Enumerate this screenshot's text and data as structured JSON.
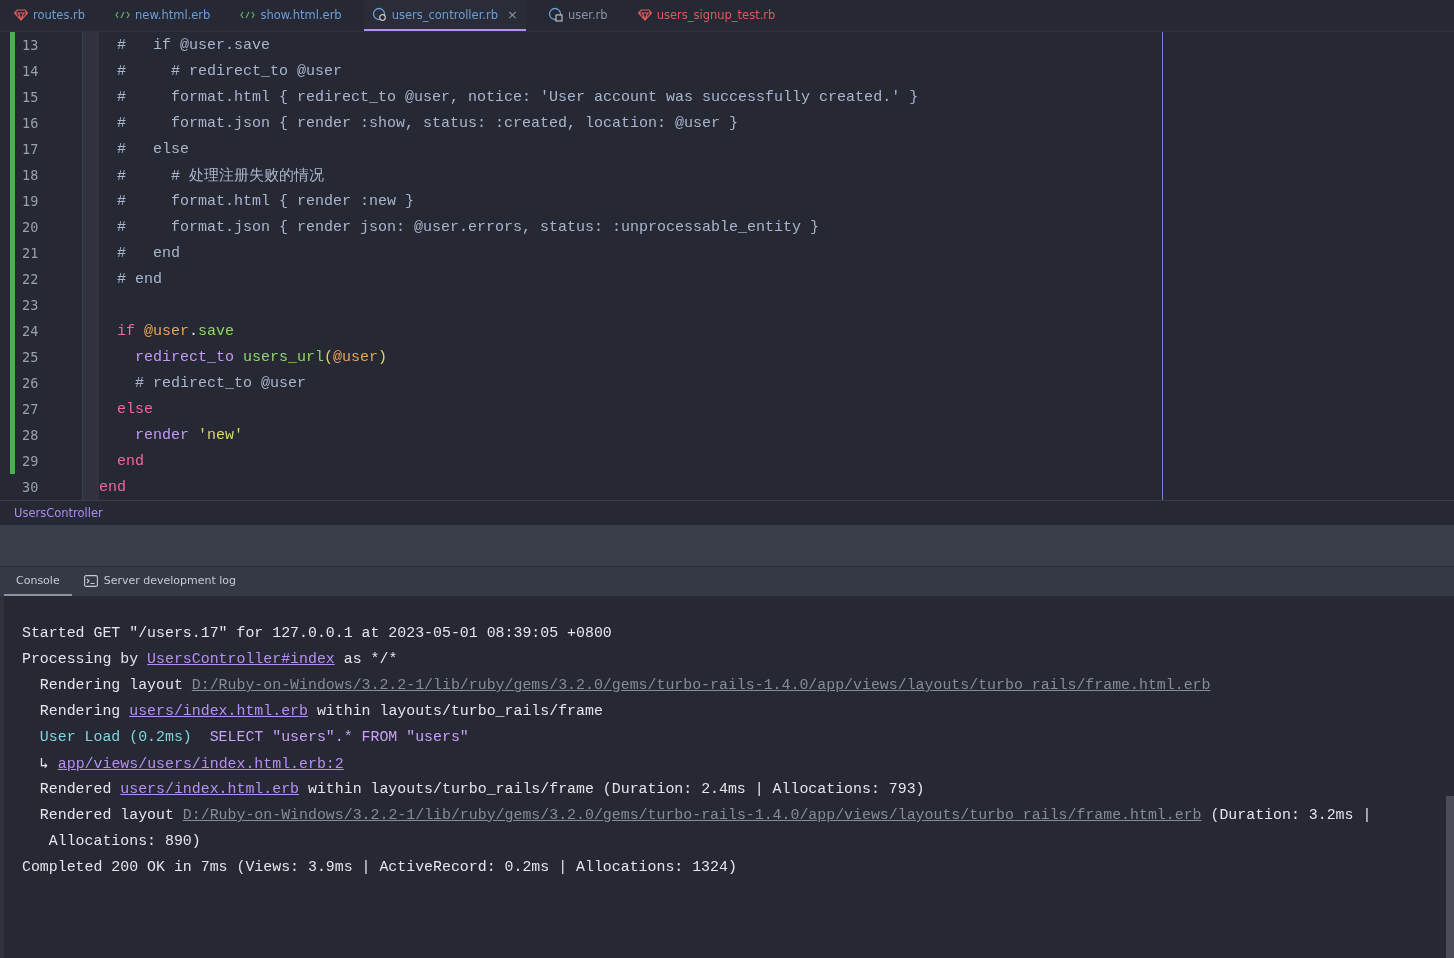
{
  "tabs": [
    {
      "label": "routes.rb",
      "kind": "gem",
      "color": "#6c9fd8",
      "selected": false
    },
    {
      "label": "new.html.erb",
      "kind": "erb",
      "color": "#6c9fd8",
      "selected": false
    },
    {
      "label": "show.html.erb",
      "kind": "erb",
      "color": "#6c9fd8",
      "selected": false
    },
    {
      "label": "users_controller.rb",
      "kind": "controller",
      "color": "#6c9fd8",
      "selected": true,
      "close": "×"
    },
    {
      "label": "user.rb",
      "kind": "model",
      "color": "#8a93a8",
      "selected": false
    },
    {
      "label": "users_signup_test.rb",
      "kind": "gem",
      "color": "#e0595e",
      "selected": false
    }
  ],
  "editor": {
    "lines": [
      {
        "number": "13",
        "modified": true,
        "tokens": [
          {
            "kind": "comment",
            "text": "  #   if @user.save"
          }
        ]
      },
      {
        "number": "14",
        "modified": true,
        "tokens": [
          {
            "kind": "comment",
            "text": "  #     # redirect_to @user"
          }
        ]
      },
      {
        "number": "15",
        "modified": true,
        "tokens": [
          {
            "kind": "comment",
            "text": "  #     format.html { redirect_to @user, notice: 'User account was successfully created.' }"
          }
        ]
      },
      {
        "number": "16",
        "modified": true,
        "tokens": [
          {
            "kind": "comment",
            "text": "  #     format.json { render :show, status: :created, location: @user }"
          }
        ]
      },
      {
        "number": "17",
        "modified": true,
        "tokens": [
          {
            "kind": "comment",
            "text": "  #   else"
          }
        ]
      },
      {
        "number": "18",
        "modified": true,
        "tokens": [
          {
            "kind": "comment",
            "text": "  #     # 处理注册失败的情况"
          }
        ]
      },
      {
        "number": "19",
        "modified": true,
        "tokens": [
          {
            "kind": "comment",
            "text": "  #     format.html { render :new }"
          }
        ]
      },
      {
        "number": "20",
        "modified": true,
        "tokens": [
          {
            "kind": "comment",
            "text": "  #     format.json { render json: @user.errors, status: :unprocessable_entity }"
          }
        ]
      },
      {
        "number": "21",
        "modified": true,
        "tokens": [
          {
            "kind": "comment",
            "text": "  #   end"
          }
        ]
      },
      {
        "number": "22",
        "modified": true,
        "tokens": [
          {
            "kind": "comment",
            "text": "  # end"
          }
        ]
      },
      {
        "number": "23",
        "modified": true
      },
      {
        "number": "24",
        "modified": true,
        "tokens": [
          {
            "kind": "keyword",
            "text": "  if "
          },
          {
            "kind": "ivar",
            "text": "@user"
          },
          {
            "kind": "plain",
            "text": "."
          },
          {
            "kind": "method",
            "text": "save"
          }
        ]
      },
      {
        "number": "25",
        "modified": true,
        "tokens": [
          {
            "kind": "call",
            "text": "    redirect_to "
          },
          {
            "kind": "method",
            "text": "users_url"
          },
          {
            "kind": "paren",
            "text": "("
          },
          {
            "kind": "ivar",
            "text": "@user"
          },
          {
            "kind": "paren",
            "text": ")"
          }
        ]
      },
      {
        "number": "26",
        "modified": true,
        "tokens": [
          {
            "kind": "comment",
            "text": "    # redirect_to @user"
          }
        ]
      },
      {
        "number": "27",
        "modified": true,
        "tokens": [
          {
            "kind": "keyword",
            "text": "  else"
          }
        ]
      },
      {
        "number": "28",
        "modified": true,
        "tokens": [
          {
            "kind": "call",
            "text": "    render "
          },
          {
            "kind": "string",
            "text": "'new'"
          }
        ]
      },
      {
        "number": "29",
        "modified": true,
        "tokens": [
          {
            "kind": "keyword",
            "text": "  end"
          }
        ]
      },
      {
        "number": "30",
        "modified": false,
        "tokens": [
          {
            "kind": "keyword",
            "text": "end"
          }
        ]
      }
    ]
  },
  "breadcrumb": "UsersController",
  "tool_tabs": [
    {
      "label": "Console",
      "selected": true
    },
    {
      "label": "Server development log",
      "kind": "terminal",
      "selected": false
    }
  ],
  "console": {
    "lines": [
      {
        "segments": [
          {
            "kind": "plain",
            "text": "Started GET \"/users.17\" for 127.0.0.1 at 2023-05-01 08:39:05 +0800"
          }
        ]
      },
      {
        "segments": [
          {
            "kind": "plain",
            "text": "Processing by "
          },
          {
            "kind": "link",
            "text": "UsersController#index"
          },
          {
            "kind": "plain",
            "text": " as */*"
          }
        ]
      },
      {
        "segments": [
          {
            "kind": "plain",
            "text": "  Rendering layout "
          },
          {
            "kind": "path",
            "text": "D:/Ruby-on-Windows/3.2.2-1/lib/ruby/gems/3.2.0/gems/turbo-rails-1.4.0/app/views/layouts/turbo_rails/frame.html.erb"
          }
        ]
      },
      {
        "segments": [
          {
            "kind": "plain",
            "text": "  Rendering "
          },
          {
            "kind": "link",
            "text": "users/index.html.erb"
          },
          {
            "kind": "plain",
            "text": " within layouts/turbo_rails/frame"
          }
        ]
      },
      {
        "segments": [
          {
            "kind": "sql_name",
            "text": "  User Load (0.2ms)  "
          },
          {
            "kind": "sql",
            "text": "SELECT \"users\".* FROM \"users\""
          }
        ]
      },
      {
        "segments": [
          {
            "kind": "plain",
            "text": "  ↳ "
          },
          {
            "kind": "link",
            "text": "app/views/users/index.html.erb:2"
          }
        ]
      },
      {
        "segments": [
          {
            "kind": "plain",
            "text": "  Rendered "
          },
          {
            "kind": "link",
            "text": "users/index.html.erb"
          },
          {
            "kind": "plain",
            "text": " within layouts/turbo_rails/frame (Duration: 2.4ms | Allocations: 793)"
          }
        ]
      },
      {
        "segments": [
          {
            "kind": "plain",
            "text": "  Rendered layout "
          },
          {
            "kind": "path",
            "text": "D:/Ruby-on-Windows/3.2.2-1/lib/ruby/gems/3.2.0/gems/turbo-rails-1.4.0/app/views/layouts/turbo_rails/frame.html.erb"
          },
          {
            "kind": "plain",
            "text": " (Duration: 3.2ms |"
          }
        ]
      },
      {
        "segments": [
          {
            "kind": "plain",
            "text": "   Allocations: 890)"
          }
        ]
      },
      {
        "segments": [
          {
            "kind": "plain",
            "text": "Completed 200 OK in 7ms (Views: 3.9ms | ActiveRecord: 0.2ms | Allocations: 1324)"
          }
        ]
      }
    ]
  }
}
